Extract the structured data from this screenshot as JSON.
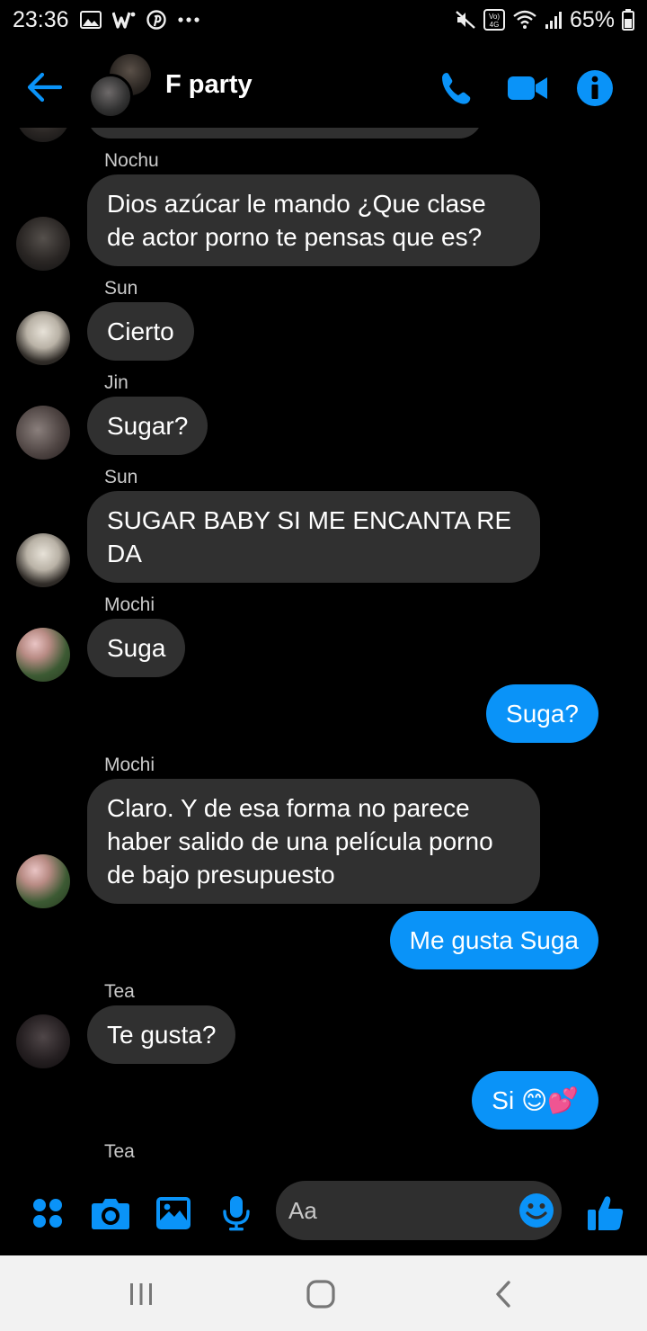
{
  "status_bar": {
    "time": "23:36",
    "battery": "65%",
    "network_badge": "Vo) 4G",
    "left_icons": [
      "gallery-icon",
      "w-app-icon",
      "pinterest-icon",
      "more-dots-icon"
    ],
    "right_icons": [
      "mute-icon",
      "volte-icon",
      "wifi-icon",
      "signal-icon",
      "battery-icon"
    ]
  },
  "header": {
    "title": "F party",
    "accent_color": "#0a93f8"
  },
  "messages": [
    {
      "sender": "Nochu",
      "text": "Dios azúcar le mando ¿Que clase de actor porno te pensas que es?"
    },
    {
      "sender": "Sun",
      "text": "Cierto"
    },
    {
      "sender": "Jin",
      "text": "Sugar?"
    },
    {
      "sender": "Sun",
      "text": "SUGAR BABY SI ME ENCANTA RE DA"
    },
    {
      "sender": "Mochi",
      "text": "Suga"
    },
    {
      "sender": "me",
      "text": "Suga?"
    },
    {
      "sender": "Mochi",
      "text": "Claro. Y de esa forma no parece haber salido de una película porno de bajo presupuesto"
    },
    {
      "sender": "me",
      "text": "Me gusta Suga"
    },
    {
      "sender": "Tea",
      "text": "Te gusta?"
    },
    {
      "sender": "me",
      "text": "Si 😊💕"
    },
    {
      "sender": "Tea",
      "text": ""
    }
  ],
  "composer": {
    "placeholder": "Aa"
  },
  "colors": {
    "background": "#000000",
    "incoming_bubble": "#303030",
    "outgoing_bubble": "#0a93f8",
    "accent": "#0a93f8"
  }
}
